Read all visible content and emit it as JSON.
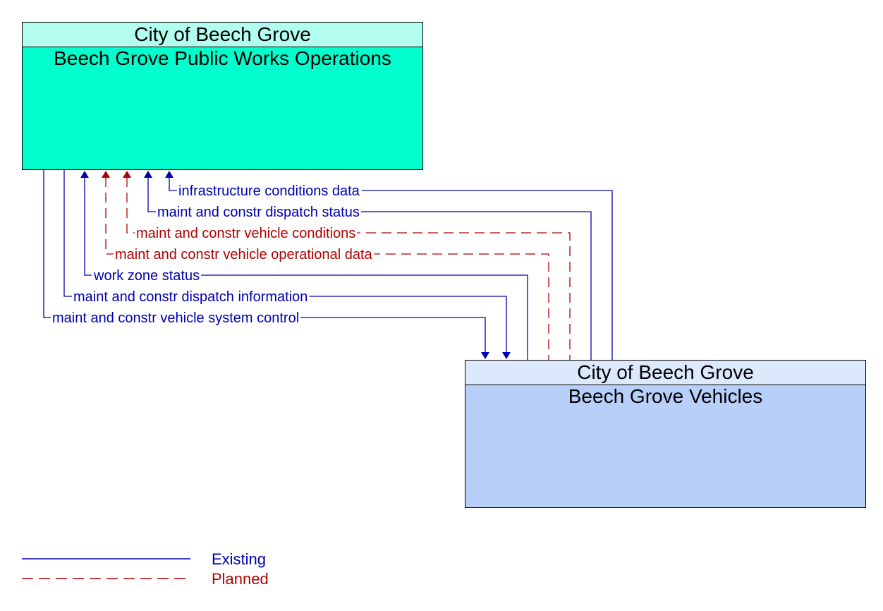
{
  "elements": {
    "source": {
      "owner": "City of Beech Grove",
      "name": "Beech Grove Public Works Operations"
    },
    "target": {
      "owner": "City of Beech Grove",
      "name": "Beech Grove Vehicles"
    }
  },
  "colors": {
    "existing": "#0000b0",
    "planned": "#b00000"
  },
  "flows": [
    {
      "label": "infrastructure conditions data",
      "status": "existing",
      "direction": "to-source"
    },
    {
      "label": "maint and constr dispatch status",
      "status": "existing",
      "direction": "to-source"
    },
    {
      "label": "maint and constr vehicle conditions",
      "status": "planned",
      "direction": "to-source"
    },
    {
      "label": "maint and constr vehicle operational data",
      "status": "planned",
      "direction": "to-source"
    },
    {
      "label": "work zone status",
      "status": "existing",
      "direction": "to-source"
    },
    {
      "label": "maint and constr dispatch information",
      "status": "existing",
      "direction": "to-target"
    },
    {
      "label": "maint and constr vehicle system control",
      "status": "existing",
      "direction": "to-target"
    }
  ],
  "legend": {
    "existing": "Existing",
    "planned": "Planned"
  }
}
